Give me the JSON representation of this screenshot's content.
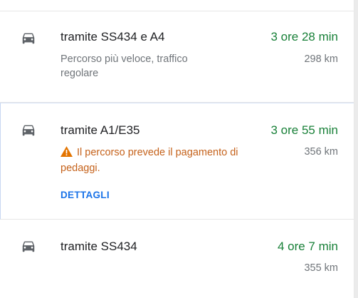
{
  "routes": [
    {
      "mode_icon": "car-icon",
      "title": "tramite SS434 e A4",
      "duration": "3 ore 28 min",
      "description": "Percorso più veloce, traffico regolare",
      "distance": "298 km"
    },
    {
      "mode_icon": "car-icon",
      "title": "tramite A1/E35",
      "duration": "3 ore 55 min",
      "warning_icon": "warning-icon",
      "warning": "Il percorso prevede il pagamento di pedaggi.",
      "distance": "356 km",
      "details_label": "DETTAGLI"
    },
    {
      "mode_icon": "car-icon",
      "title": "tramite SS434",
      "duration": "4 ore 7 min",
      "distance": "355 km"
    }
  ],
  "colors": {
    "duration": "#188038",
    "warning": "#c5621b",
    "link": "#1a73e8",
    "secondary_text": "#70757a"
  }
}
